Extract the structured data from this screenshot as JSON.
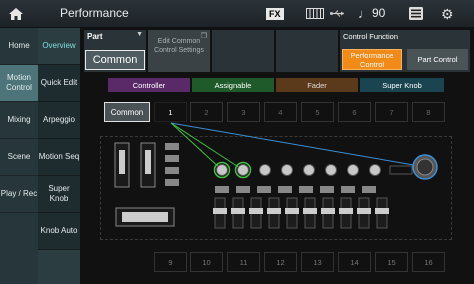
{
  "topbar": {
    "title": "Performance",
    "fx": "FX",
    "tempo": "90",
    "icons": [
      "home-icon",
      "keyboard-icon",
      "usb-icon",
      "note-icon",
      "list-icon",
      "gear-icon"
    ]
  },
  "nav_left": [
    {
      "label": "Home"
    },
    {
      "label": "Motion Control",
      "active": true
    },
    {
      "label": "Mixing"
    },
    {
      "label": "Scene"
    },
    {
      "label": "Play / Rec"
    }
  ],
  "nav_right": [
    {
      "label": "Overview",
      "active": true
    },
    {
      "label": "Quick Edit"
    },
    {
      "label": "Arpeggio"
    },
    {
      "label": "Motion Seq"
    },
    {
      "label": "Super Knob"
    },
    {
      "label": "Knob Auto"
    }
  ],
  "header": {
    "part_label": "Part",
    "part_value": "Common",
    "edit_common": "Edit Common Control Settings",
    "control_function_label": "Control Function",
    "performance_control": "Performance Control",
    "part_control": "Part Control"
  },
  "categories": [
    {
      "label": "Controller",
      "color": "#5a2a68"
    },
    {
      "label": "Assignable",
      "color": "#1f5a2a"
    },
    {
      "label": "Fader",
      "color": "#5a3a1a"
    },
    {
      "label": "Super Knob",
      "color": "#1a4550"
    }
  ],
  "selector": {
    "common": "Common",
    "top": [
      "1",
      "2",
      "3",
      "4",
      "5",
      "6",
      "7",
      "8"
    ],
    "bottom": [
      "9",
      "10",
      "11",
      "12",
      "13",
      "14",
      "15",
      "16"
    ]
  }
}
